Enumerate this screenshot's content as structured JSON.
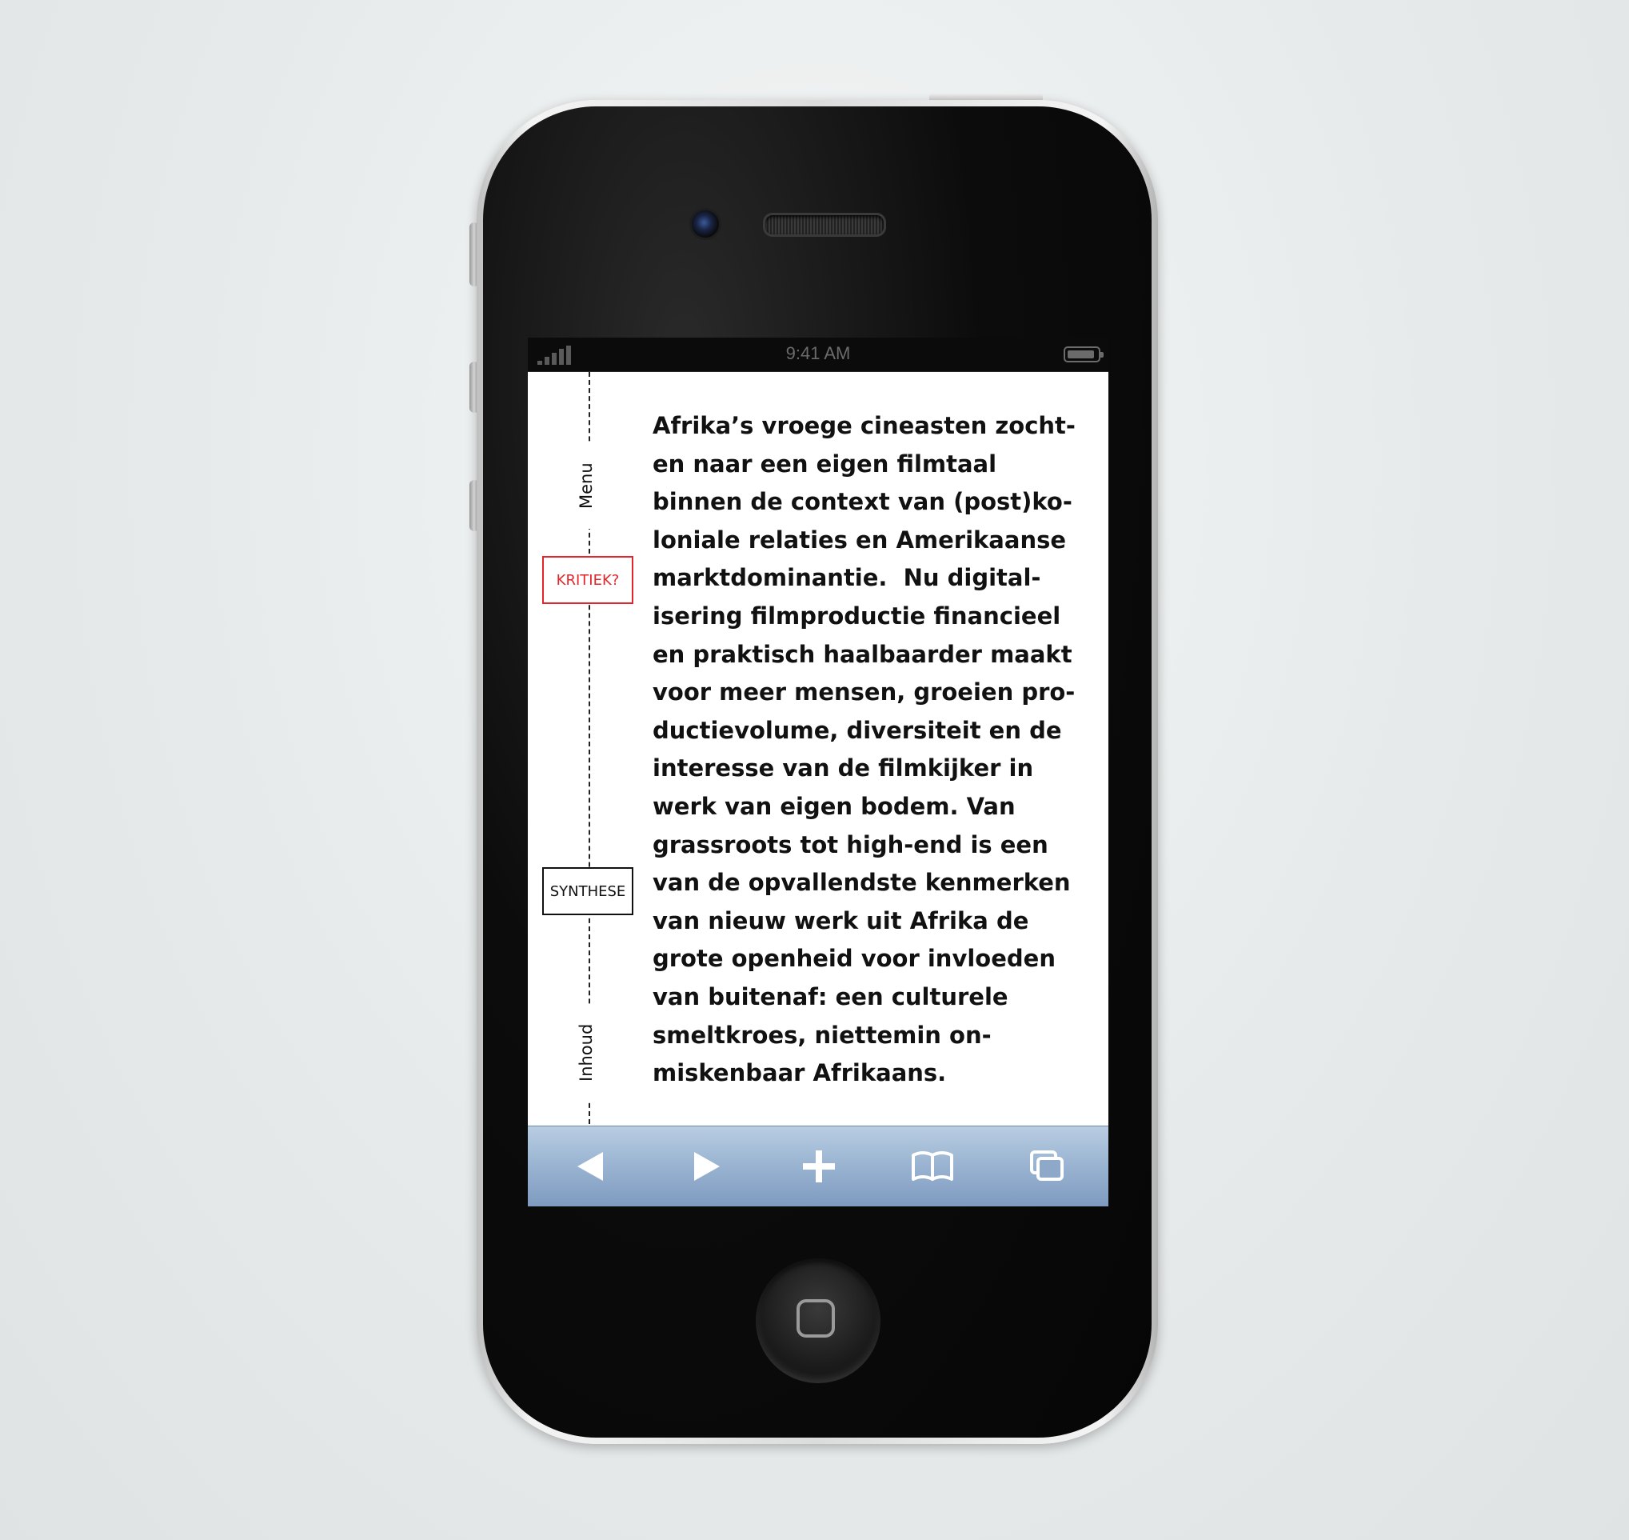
{
  "status_bar": {
    "time": "9:41 AM"
  },
  "rail": {
    "menu_label": "Menu",
    "inhoud_label": "Inhoud"
  },
  "sections": {
    "kritiek": "KRITIEK?",
    "synthese": "SYNTHESE"
  },
  "article": {
    "lines": [
      "Afrika’s vroege cineasten zocht-",
      "en naar een eigen filmtaal",
      "binnen de context van (post)ko-",
      "loniale relaties en Amerikaanse",
      "marktdominantie.  Nu digital-",
      "isering filmproductie financieel",
      "en praktisch haalbaarder maakt",
      "voor meer mensen, groeien pro-",
      "ductievolume, diversiteit en de",
      "interesse van de filmkijker in",
      "werk van eigen bodem. Van",
      "grassroots tot high-end is een",
      "van de opvallendste kenmerken",
      "van nieuw werk uit Afrika de",
      "grote openheid voor invloeden",
      "van buitenaf: een culturele",
      "smeltkroes, niettemin on-",
      "miskenbaar Afrikaans."
    ]
  },
  "toolbar": {
    "buttons": [
      "back-icon",
      "forward-icon",
      "add-icon",
      "bookmarks-icon",
      "tabs-icon"
    ]
  },
  "colors": {
    "accent_red": "#e3262b",
    "toolbar_blue": "#9bb5d2",
    "text": "#111111"
  }
}
